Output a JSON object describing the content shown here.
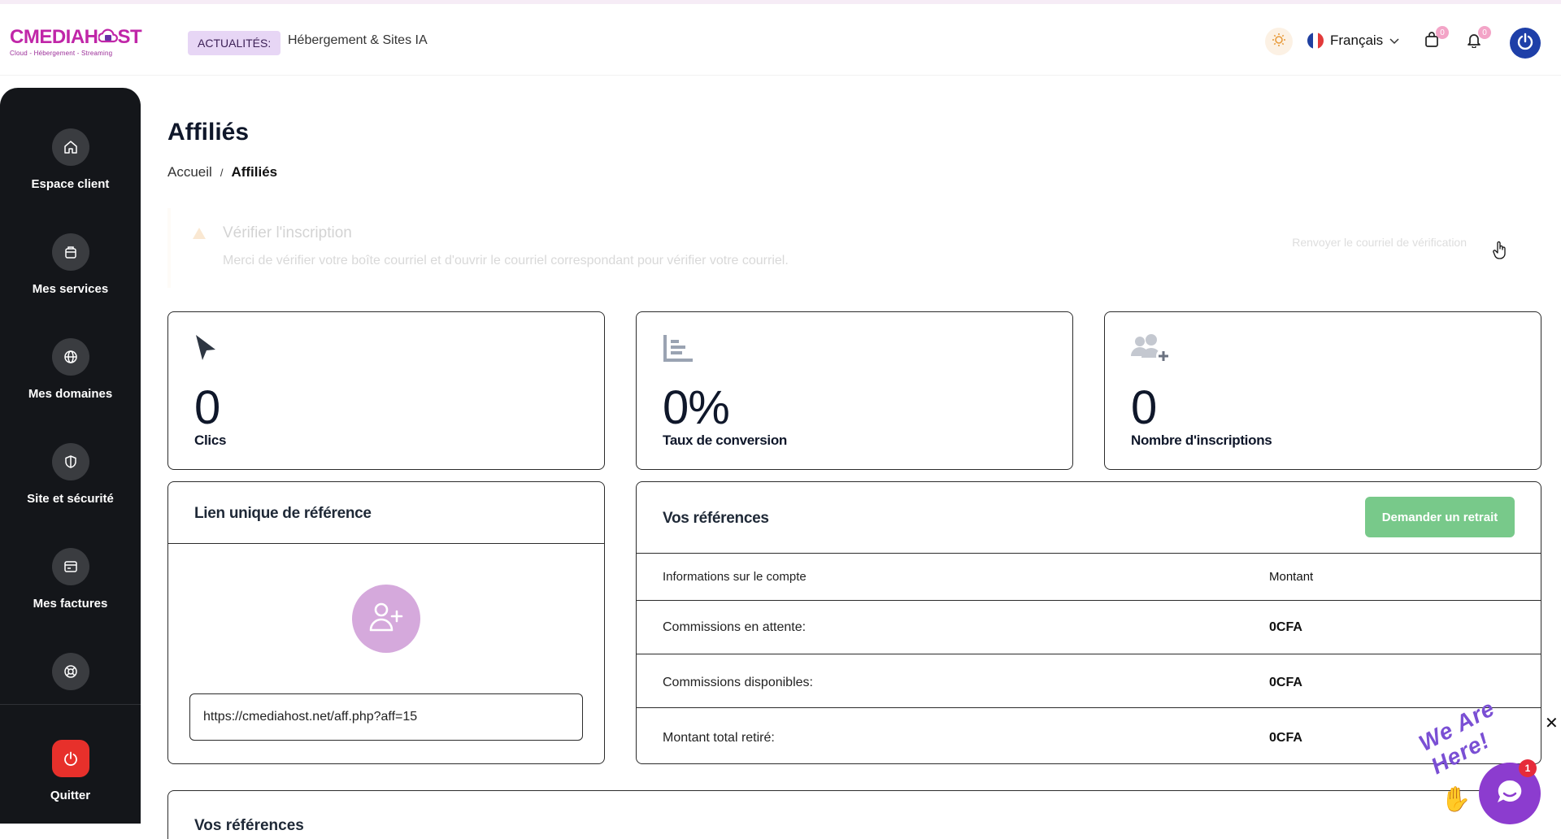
{
  "header": {
    "logo_text": "CMEDIAHOST",
    "logo_left": "CMEDIAH",
    "logo_right": "ST",
    "logo_tagline": "Cloud - Hébergement - Streaming",
    "news_label": "ACTUALITÉS:",
    "news_text": "Hébergement & Sites IA",
    "language": "Français",
    "cart_count": "0",
    "notif_count": "0"
  },
  "sidebar": {
    "items": [
      {
        "label": "Espace client",
        "icon": "home-icon"
      },
      {
        "label": "Mes services",
        "icon": "box-icon"
      },
      {
        "label": "Mes domaines",
        "icon": "globe-icon"
      },
      {
        "label": "Site et sécurité",
        "icon": "shield-icon"
      },
      {
        "label": "Mes factures",
        "icon": "invoice-icon"
      },
      {
        "label": "",
        "icon": "lifebuoy-icon"
      }
    ],
    "quit_label": "Quitter"
  },
  "page": {
    "title": "Affiliés",
    "breadcrumb_home": "Accueil",
    "breadcrumb_sep": "/",
    "breadcrumb_current": "Affiliés"
  },
  "alert": {
    "title": "Vérifier l'inscription",
    "text": "Merci de vérifier votre boîte courriel et d'ouvrir le courriel correspondant pour vérifier votre courriel.",
    "action": "Renvoyer le courriel de vérification"
  },
  "stats": [
    {
      "value": "0",
      "label": "Clics",
      "icon": "cursor-icon"
    },
    {
      "value": "0%",
      "label": "Taux de conversion",
      "icon": "bar-chart-icon"
    },
    {
      "value": "0",
      "label": "Nombre d'inscriptions",
      "icon": "users-plus-icon"
    }
  ],
  "referral_link": {
    "title": "Lien unique de référence",
    "url": "https://cmediahost.net/aff.php?aff=15"
  },
  "references": {
    "title": "Vos références",
    "withdraw_label": "Demander un retrait",
    "col_account": "Informations sur le compte",
    "col_amount": "Montant",
    "rows": [
      {
        "label": "Commissions en attente:",
        "amount": "0CFA"
      },
      {
        "label": "Commissions disponibles:",
        "amount": "0CFA"
      },
      {
        "label": "Montant total retiré:",
        "amount": "0CFA"
      }
    ]
  },
  "bottom_section": {
    "title": "Vos références"
  },
  "chat": {
    "wave_text": "We Are Here!",
    "badge": "1",
    "close": "✕"
  },
  "colors": {
    "sidebar_bg": "#14161a",
    "brand": "#c026a8",
    "withdraw": "#78c98a",
    "quit": "#e7302b",
    "power": "#1e3fa8",
    "chat": "#8c3ccf"
  }
}
